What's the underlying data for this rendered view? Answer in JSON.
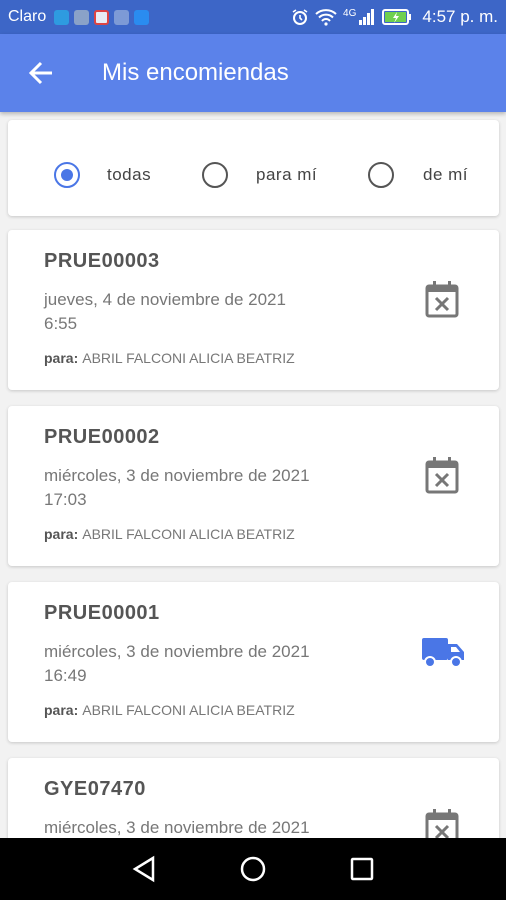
{
  "status_bar": {
    "carrier": "Claro",
    "network": "4G",
    "time": "4:57 p. m."
  },
  "app_bar": {
    "title": "Mis encomiendas"
  },
  "filter": {
    "options": [
      {
        "label": "todas",
        "selected": true
      },
      {
        "label": "para mí",
        "selected": false
      },
      {
        "label": "de mí",
        "selected": false
      }
    ]
  },
  "shipments": [
    {
      "code": "PRUE00003",
      "date": "jueves, 4 de noviembre de 2021",
      "time": "6:55",
      "para_label": "para:",
      "recipient": "ABRIL FALCONI ALICIA BEATRIZ",
      "status_icon": "calendar-x-icon"
    },
    {
      "code": "PRUE00002",
      "date": "miércoles, 3 de noviembre de 2021",
      "time": "17:03",
      "para_label": "para:",
      "recipient": "ABRIL FALCONI ALICIA BEATRIZ",
      "status_icon": "calendar-x-icon"
    },
    {
      "code": "PRUE00001",
      "date": "miércoles, 3 de noviembre de 2021",
      "time": "16:49",
      "para_label": "para:",
      "recipient": "ABRIL FALCONI ALICIA BEATRIZ",
      "status_icon": "truck-icon"
    },
    {
      "code": "GYE07470",
      "date": "miércoles, 3 de noviembre de 2021",
      "time": "",
      "para_label": "",
      "recipient": "",
      "status_icon": "calendar-x-icon"
    }
  ],
  "colors": {
    "status_bar": "#3d66c7",
    "app_bar": "#5b82ea",
    "accent": "#4a76e6",
    "icon_grey": "#777777"
  }
}
